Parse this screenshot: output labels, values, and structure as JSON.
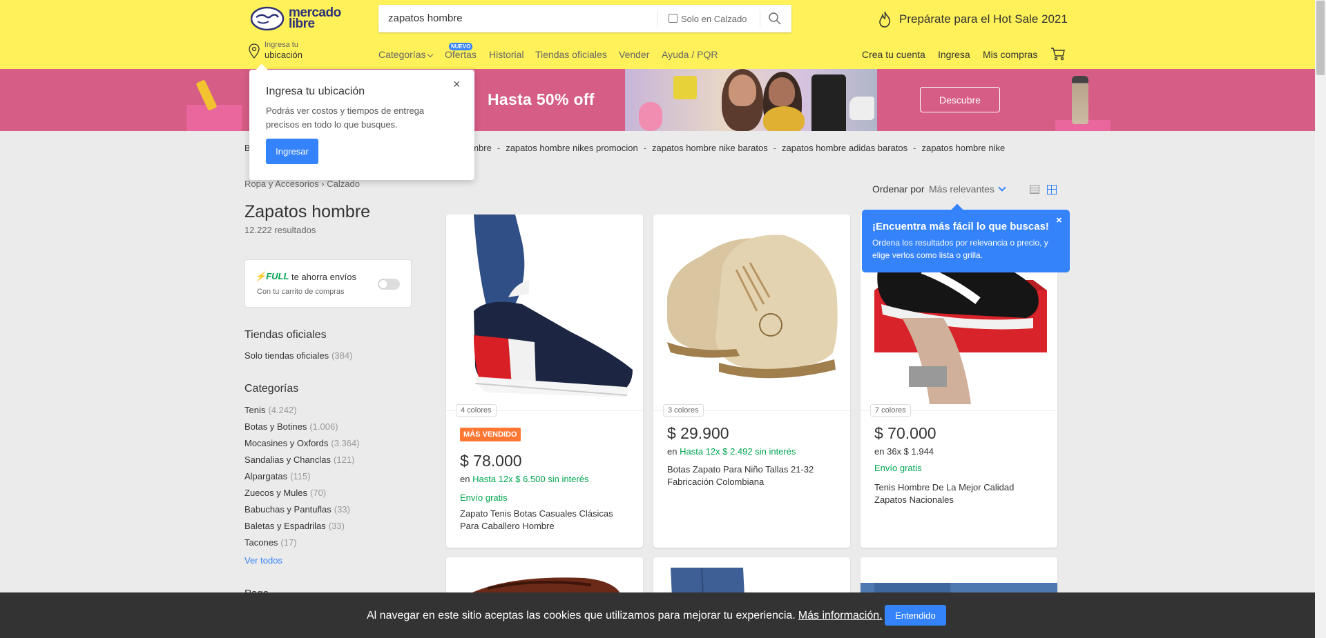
{
  "header": {
    "logo_text_line1": "mercado",
    "logo_text_line2": "libre",
    "search_value": "zapatos hombre",
    "search_filter_label": "Solo en Calzado",
    "promo_text": "Prepárate para el Hot Sale 2021",
    "location_small": "Ingresa tu",
    "location_big": "ubicación",
    "nav": [
      "Categorías",
      "Ofertas",
      "Historial",
      "Tiendas oficiales",
      "Vender",
      "Ayuda / PQR"
    ],
    "new_badge": "NUEVO",
    "right_nav": [
      "Crea tu cuenta",
      "Ingresa",
      "Mis compras"
    ]
  },
  "banner": {
    "text": "Hasta 50% off",
    "button": "Descubre"
  },
  "related": {
    "first_truncated": "B",
    "items": [
      "ombre",
      "zapatos hombre nikes promocion",
      "zapatos hombre nike baratos",
      "zapatos hombre adidas baratos",
      "zapatos hombre nike"
    ],
    "separator": "-"
  },
  "sidebar": {
    "breadcrumb": [
      "Ropa y Accesorios",
      "Calzado"
    ],
    "title": "Zapatos hombre",
    "results": "12.222 resultados",
    "full_logo": "FULL",
    "full_text": "te ahorra envíos",
    "full_sub": "Con tu carrito de compras",
    "official_heading": "Tiendas oficiales",
    "official_item": "Solo tiendas oficiales",
    "official_count": "(384)",
    "categories_heading": "Categorías",
    "categories": [
      {
        "label": "Tenis",
        "count": "(4.242)"
      },
      {
        "label": "Botas y Botines",
        "count": "(1.006)"
      },
      {
        "label": "Mocasines y Oxfords",
        "count": "(3.364)"
      },
      {
        "label": "Sandalias y Chanclas",
        "count": "(121)"
      },
      {
        "label": "Alpargatas",
        "count": "(115)"
      },
      {
        "label": "Zuecos y Mules",
        "count": "(70)"
      },
      {
        "label": "Babuchas y Pantuflas",
        "count": "(33)"
      },
      {
        "label": "Baletas y Espadrilas",
        "count": "(33)"
      },
      {
        "label": "Tacones",
        "count": "(17)"
      }
    ],
    "see_all": "Ver todos",
    "next_heading_partial": "Pago"
  },
  "sort": {
    "label": "Ordenar por",
    "value": "Más relevantes"
  },
  "products": [
    {
      "colors": "4 colores",
      "badge": "MÁS VENDIDO",
      "price": "$ 78.000",
      "installments_prefix": "en",
      "installments": "Hasta 12x $ 6.500 sin interés",
      "shipping": "Envío gratis",
      "title": "Zapato Tenis Botas Casuales Clásicas Para Caballero Hombre"
    },
    {
      "colors": "3 colores",
      "price": "$ 29.900",
      "installments_prefix": "en",
      "installments": "Hasta 12x $ 2.492 sin interés",
      "title": "Botas Zapato Para Niño Tallas 21-32 Fabricación Colombiana"
    },
    {
      "colors": "7 colores",
      "price": "$ 70.000",
      "installments_prefix": "en",
      "installments_plain": "36x $ 1.944",
      "shipping": "Envío gratis",
      "title": "Tenis Hombre De La Mejor Calidad Zapatos Nacionales"
    }
  ],
  "location_popup": {
    "title": "Ingresa tu ubicación",
    "body": "Podrás ver costos y tiempos de entrega precisos en todo lo que busques.",
    "button": "Ingresar",
    "close": "×"
  },
  "tooltip": {
    "title": "¡Encuentra más fácil lo que buscas!",
    "body": "Ordena los resultados por relevancia o precio, y elige verlos como lista o grilla.",
    "close": "×"
  },
  "cookie": {
    "text": "Al navegar en este sitio aceptas las cookies que utilizamos para mejorar tu experiencia.",
    "link": "Más información.",
    "button": "Entendido"
  },
  "colors": {
    "header_bg": "#fff159",
    "brand_navy": "#2d3277",
    "accent_blue": "#3483fa",
    "green": "#00a650",
    "best_seller": "#ff7733",
    "banner_pink": "#d65d86"
  }
}
